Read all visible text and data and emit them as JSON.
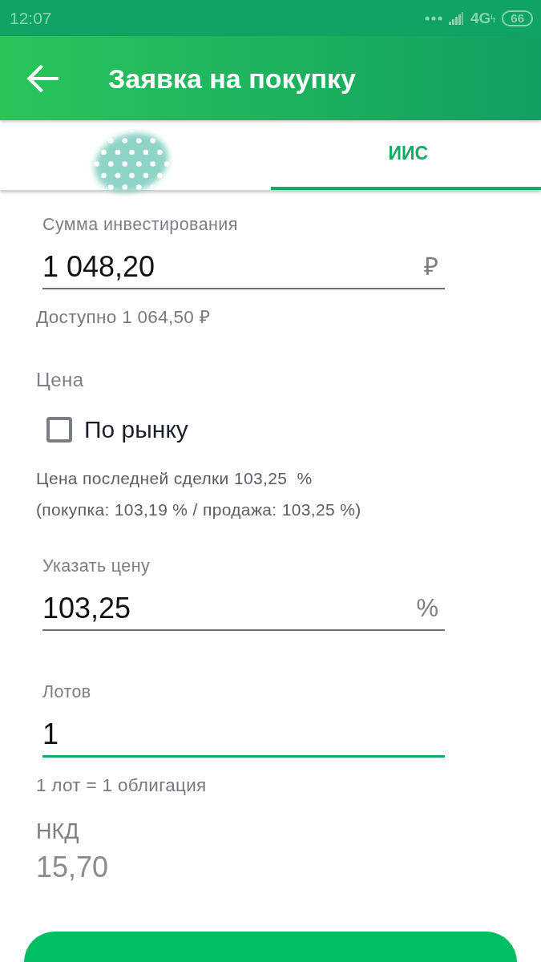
{
  "status_bar": {
    "time": "12:07",
    "network": "4G",
    "battery": "66"
  },
  "header": {
    "title": "Заявка на покупку"
  },
  "tabs": [
    {
      "selected": false,
      "covered": true
    },
    {
      "label": "ИИС",
      "selected": true,
      "covered": false
    }
  ],
  "form": [
    {
      "kind": "field",
      "label": "Сумма инвестирования",
      "value": "1 048,20",
      "unit": "₽",
      "focused": false
    },
    {
      "kind": "hint",
      "text": "Доступно 1 064,50 ₽"
    },
    {
      "kind": "heading",
      "text": "Цена"
    },
    {
      "kind": "checkbox",
      "label": "По рынку",
      "checked": false
    },
    {
      "kind": "note",
      "text": "Цена последней сделки 103,25  %"
    },
    {
      "kind": "note",
      "text": "(покупка: 103,19 % / продажа: 103,25 %)"
    },
    {
      "kind": "field",
      "label": "Указать цену",
      "value": "103,25",
      "unit": "%",
      "focused": false
    },
    {
      "kind": "field",
      "label": "Лотов",
      "value": "1",
      "focused": true
    },
    {
      "kind": "hint",
      "text": "1 лот = 1 облигация"
    },
    {
      "kind": "stat",
      "label": "НКД",
      "value": "15,70"
    }
  ],
  "buttons": [
    {
      "kind": "primary"
    }
  ]
}
